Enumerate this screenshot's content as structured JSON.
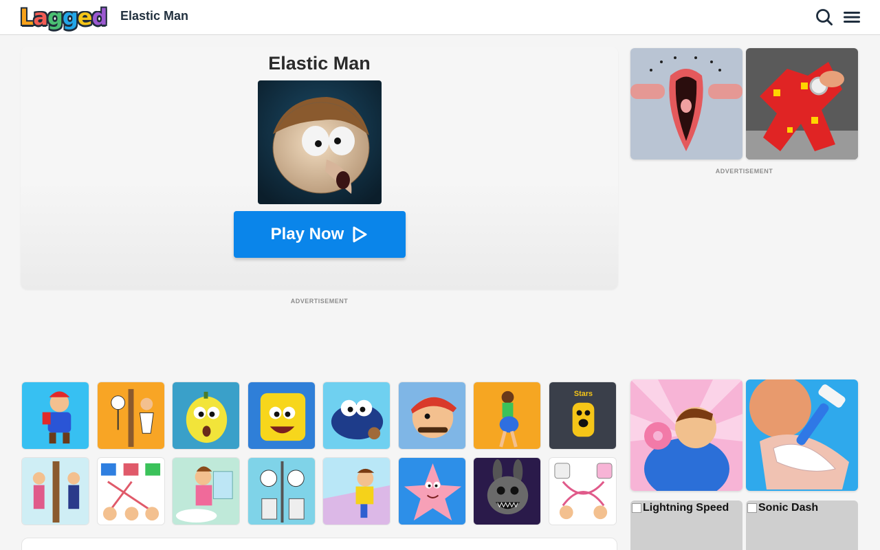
{
  "header": {
    "logo_letters": [
      "L",
      "a",
      "g",
      "g",
      "e",
      "d"
    ],
    "logo_colors": [
      "#f7a21b",
      "#f25c54",
      "#4bbf73",
      "#23a6e8",
      "#f5c518",
      "#9b59d0"
    ],
    "title": "Elastic Man"
  },
  "main": {
    "game_title": "Elastic Man",
    "play_label": "Play Now",
    "ad_label": "ADVERTISEMENT"
  },
  "side": {
    "ad_label": "ADVERTISEMENT",
    "broken_tiles": [
      "Lightning Speed",
      "Sonic Dash"
    ]
  },
  "grid_games": [
    {
      "icon": "runner-plumber",
      "bg": "#37c0f2"
    },
    {
      "icon": "stickman-door",
      "bg": "#f8a525"
    },
    {
      "icon": "lemon-face",
      "bg": "#3aa0c9"
    },
    {
      "icon": "sponge-face",
      "bg": "#2f7fd8"
    },
    {
      "icon": "blue-monster",
      "bg": "#6fd0f0"
    },
    {
      "icon": "plumber-face",
      "bg": "#7fb6e6"
    },
    {
      "icon": "runner-girl",
      "bg": "#f6a622"
    },
    {
      "icon": "stretchy-stars",
      "bg": "#3a3f4a"
    },
    {
      "icon": "door-police",
      "bg": "#cfeef5"
    },
    {
      "icon": "connect-houses",
      "bg": "#ffffff"
    },
    {
      "icon": "mom-bath",
      "bg": "#bfe9d9"
    },
    {
      "icon": "toilet-troll",
      "bg": "#7fd3e8"
    },
    {
      "icon": "speed-runner",
      "bg": "#b9e7f7"
    },
    {
      "icon": "starfish",
      "bg": "#2d8fe8"
    },
    {
      "icon": "scary-bunny",
      "bg": "#2a1a4a"
    },
    {
      "icon": "toilet-love",
      "bg": "#ffffff"
    }
  ]
}
